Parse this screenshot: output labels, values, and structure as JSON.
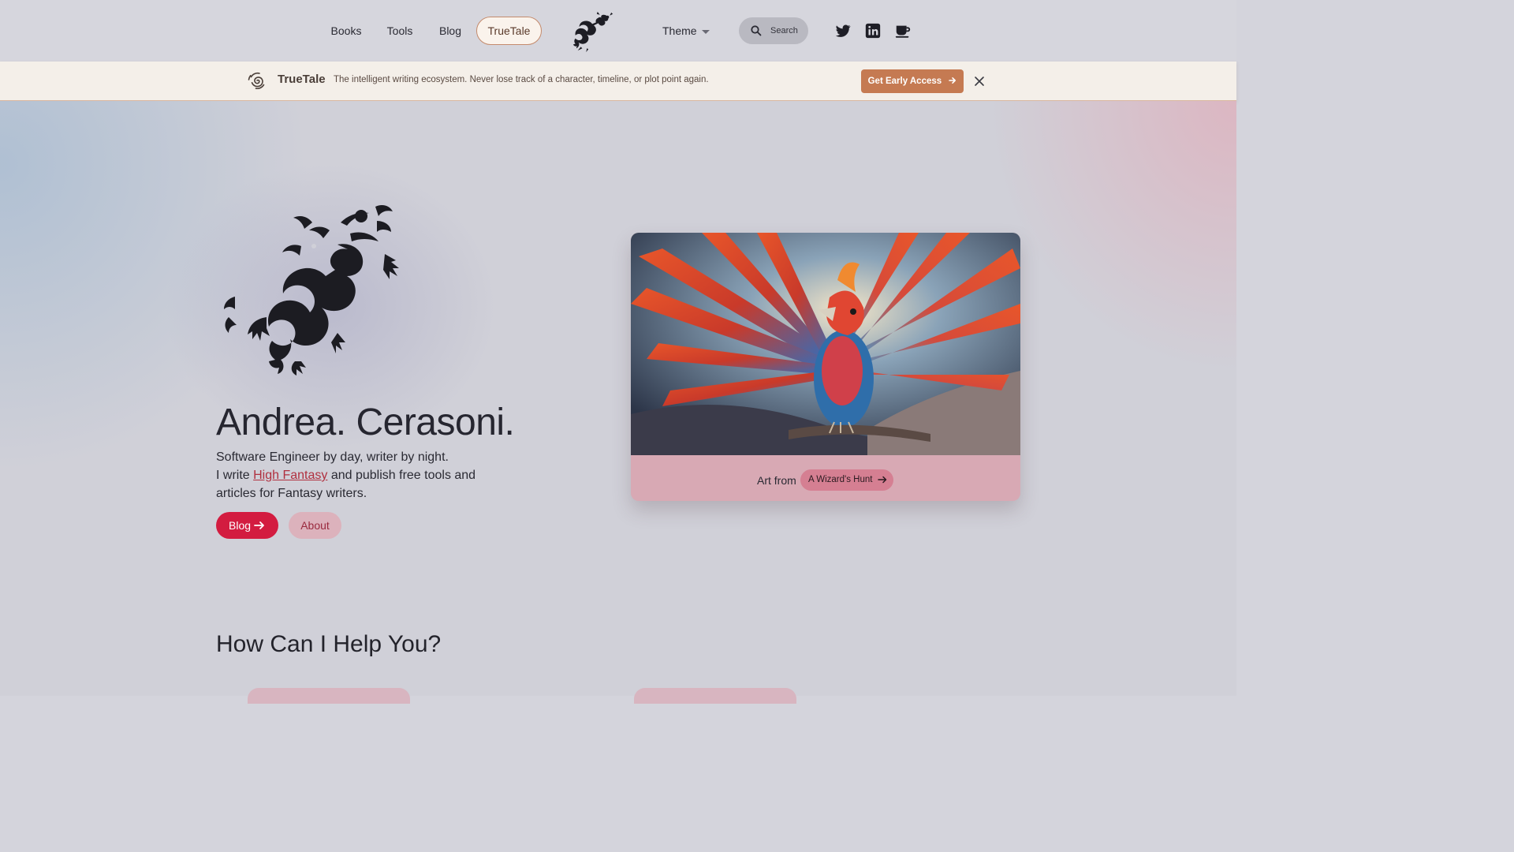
{
  "nav": {
    "links": [
      {
        "label": "Books"
      },
      {
        "label": "Tools"
      },
      {
        "label": "Blog"
      }
    ],
    "highlight_label": "TrueTale",
    "theme_label": "Theme",
    "search_placeholder": "Search",
    "social_icons": [
      "twitter-icon",
      "linkedin-icon",
      "coffee-cup-icon"
    ]
  },
  "banner": {
    "brand": "TrueTale",
    "tagline": "The intelligent writing ecosystem. Never lose track of a character, timeline, or plot point again.",
    "cta_label": "Get Early Access",
    "accent_color": "#c57a52"
  },
  "hero": {
    "title": "Andrea. Cerasoni.",
    "line1": "Software Engineer by day, writer by night.",
    "line2_pre": "I write ",
    "line2_link": "High Fantasy",
    "line2_post": " and publish free tools and articles for Fantasy writers.",
    "blog_label": "Blog",
    "about_label": "About",
    "primary_color": "#d31c40"
  },
  "art_card": {
    "caption": "Art from",
    "link_label": "A Wizard's Hunt"
  },
  "help": {
    "title": "How Can I Help You?"
  }
}
